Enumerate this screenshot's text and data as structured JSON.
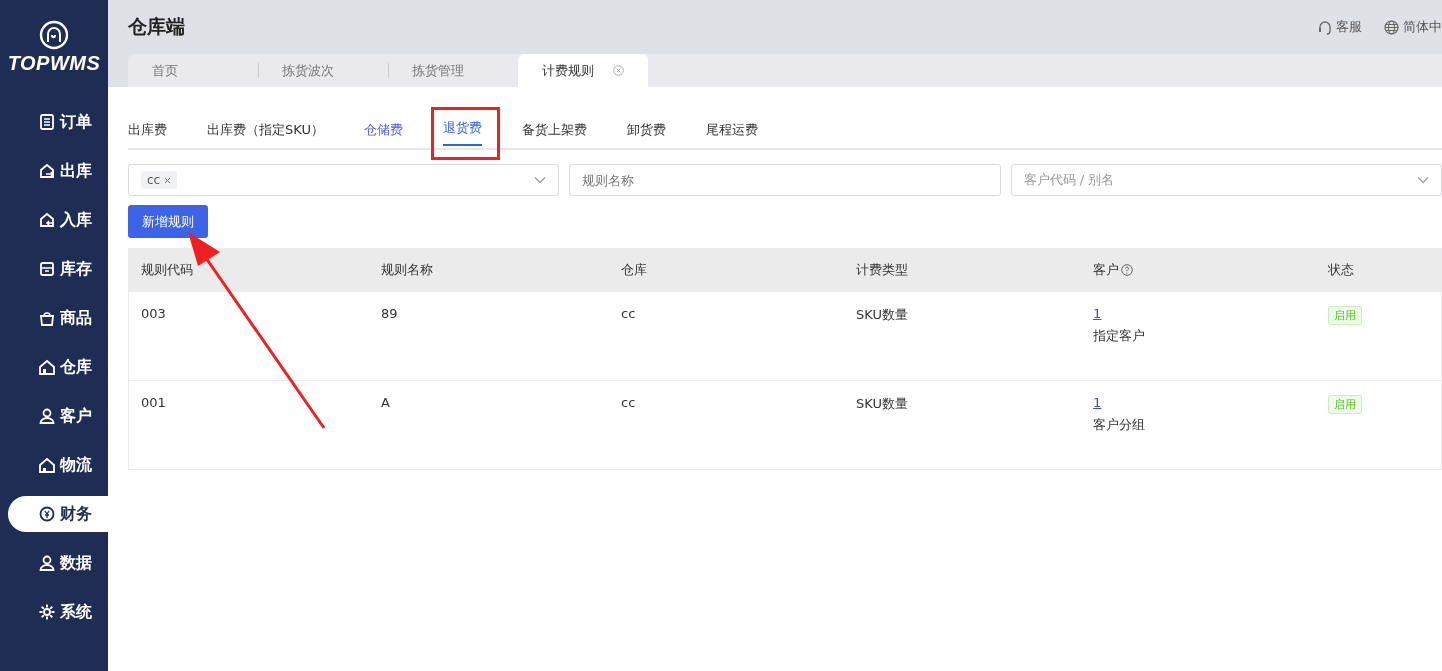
{
  "sidebar": {
    "logo_text": "TOPWMS",
    "items": [
      {
        "label": "订单",
        "selected": false
      },
      {
        "label": "出库",
        "selected": false
      },
      {
        "label": "入库",
        "selected": false
      },
      {
        "label": "库存",
        "selected": false
      },
      {
        "label": "商品",
        "selected": false
      },
      {
        "label": "仓库",
        "selected": false
      },
      {
        "label": "客户",
        "selected": false
      },
      {
        "label": "物流",
        "selected": false
      },
      {
        "label": "财务",
        "selected": true
      },
      {
        "label": "数据",
        "selected": false
      },
      {
        "label": "系统",
        "selected": false
      }
    ]
  },
  "header": {
    "title": "仓库端",
    "service": "客服",
    "language": "简体中"
  },
  "page_tabs": [
    {
      "label": "首页",
      "selected": false,
      "closable": false
    },
    {
      "label": "拣货波次",
      "selected": false,
      "closable": false
    },
    {
      "label": "拣货管理",
      "selected": false,
      "closable": false
    },
    {
      "label": "计费规则",
      "selected": true,
      "closable": true
    }
  ],
  "fee_tabs": [
    {
      "label": "出库费",
      "selected": false,
      "hovered": false
    },
    {
      "label": "出库费（指定SKU）",
      "selected": false,
      "hovered": false
    },
    {
      "label": "仓储费",
      "selected": false,
      "hovered": true
    },
    {
      "label": "退货费",
      "selected": true,
      "hovered": false
    },
    {
      "label": "备货上架费",
      "selected": false,
      "hovered": false
    },
    {
      "label": "卸货费",
      "selected": false,
      "hovered": false
    },
    {
      "label": "尾程运费",
      "selected": false,
      "hovered": false
    }
  ],
  "filters": {
    "warehouse_tags": [
      "cc"
    ],
    "rule_name": {
      "placeholder": "规则名称"
    },
    "customer": {
      "placeholder": "客户代码 / 别名"
    }
  },
  "add_button": "新增规则",
  "table": {
    "columns": [
      "规则代码",
      "规则名称",
      "仓库",
      "计费类型",
      "客户",
      "状态"
    ],
    "rows": [
      {
        "code": "003",
        "name": "89",
        "warehouse": "cc",
        "fee_type": "SKU数量",
        "customer_count": "1",
        "customer_scope": "指定客户",
        "status": "启用"
      },
      {
        "code": "001",
        "name": "A",
        "warehouse": "cc",
        "fee_type": "SKU数量",
        "customer_count": "1",
        "customer_scope": "客户分组",
        "status": "启用"
      }
    ]
  },
  "annotation_box_on_selected_tab": true,
  "annotation_arrow": true
}
